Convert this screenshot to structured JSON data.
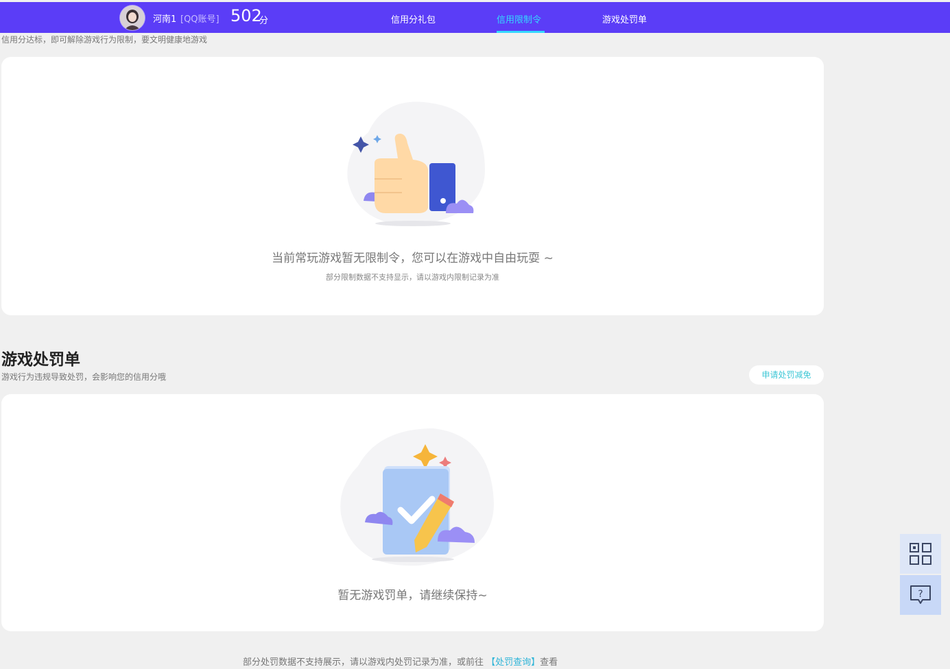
{
  "header": {
    "user_name": "河南1",
    "account_type": "[QQ账号]",
    "score": "502",
    "score_unit": "分",
    "tabs": [
      {
        "label": "信用分礼包",
        "active": false
      },
      {
        "label": "信用限制令",
        "active": true
      },
      {
        "label": "游戏处罚单",
        "active": false
      }
    ],
    "brand_color": "#5b3df7",
    "active_color": "#34d8ff"
  },
  "restriction": {
    "description": "信用分达标，即可解除游戏行为限制，要文明健康地游戏",
    "empty_main": "当前常玩游戏暂无限制令，您可以在游戏中自由玩耍 ~",
    "empty_sub": "部分限制数据不支持显示，请以游戏内限制记录为准",
    "illustration_icon": "thumbs-up-icon"
  },
  "penalty": {
    "title": "游戏处罚单",
    "description": "游戏行为违规导致处罚，会影响您的信用分哦",
    "appeal_button": "申请处罚减免",
    "empty_main": "暂无游戏罚单，请继续保持~",
    "illustration_icon": "checklist-pencil-icon"
  },
  "footer": {
    "prefix": "部分处罚数据不支持展示，请以游戏内处罚记录为准，或前往",
    "link": "【处罚查询】",
    "suffix": "查看"
  },
  "side_tools": [
    {
      "icon": "qr-code-icon"
    },
    {
      "icon": "help-chat-icon"
    }
  ]
}
